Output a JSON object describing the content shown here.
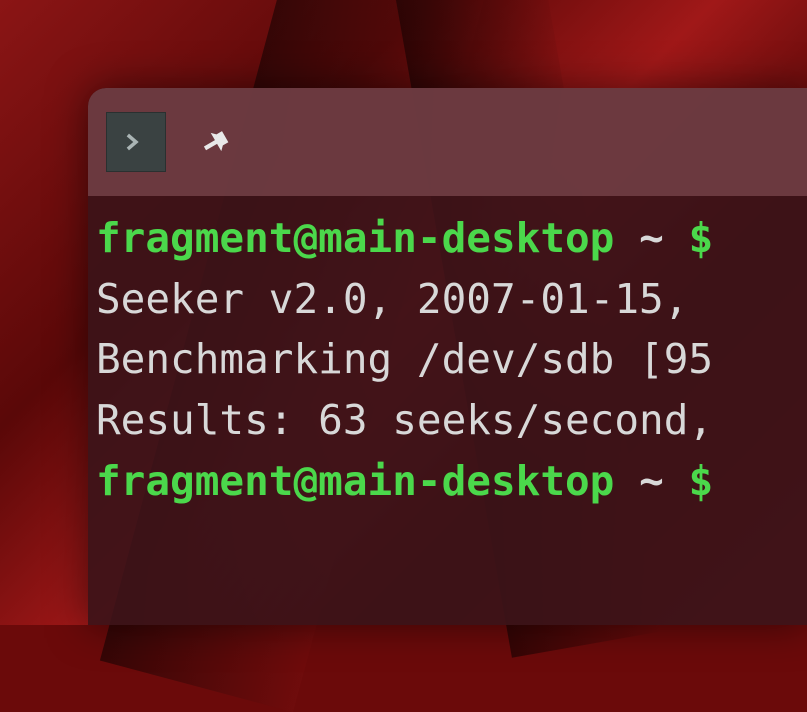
{
  "prompt": {
    "user_host": "fragment@main-desktop",
    "path": "~",
    "symbol": "$"
  },
  "output": {
    "line1": "Seeker v2.0, 2007-01-15,",
    "line2": "Benchmarking /dev/sdb [95",
    "line3": "Results: 63 seeks/second,"
  },
  "icons": {
    "terminal_tab": "terminal-prompt-icon",
    "pin": "pin-icon"
  }
}
